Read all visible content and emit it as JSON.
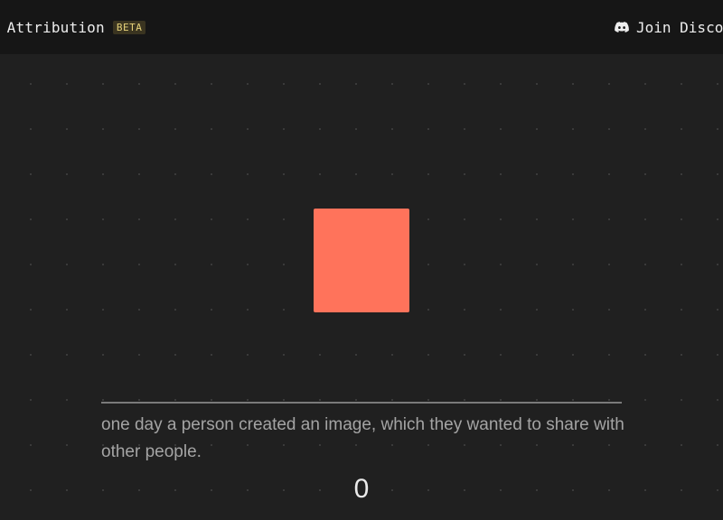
{
  "header": {
    "title": "e Attribution",
    "badge": "BETA",
    "discord_label": "Join Disco",
    "discord_icon": "discord-icon"
  },
  "canvas": {
    "square_color": "#ff735b"
  },
  "story": {
    "text": "one day a person created an image, which they wanted to share with other people."
  },
  "counter": {
    "value": "0"
  },
  "colors": {
    "background": "#202020",
    "header_background": "#161616",
    "badge_text": "#e6d27a"
  }
}
